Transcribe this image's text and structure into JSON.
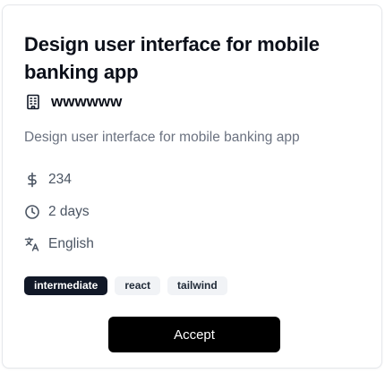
{
  "card": {
    "title": "Design user interface for mobile banking app",
    "company": "wwwwww",
    "description": "Design user interface for mobile banking app",
    "price": "234",
    "duration": "2 days",
    "language": "English",
    "tags": [
      "intermediate",
      "react",
      "tailwind"
    ],
    "accept_label": "Accept"
  },
  "icons": {
    "company": "building-icon",
    "price": "dollar-icon",
    "duration": "clock-icon",
    "language": "translate-icon"
  }
}
